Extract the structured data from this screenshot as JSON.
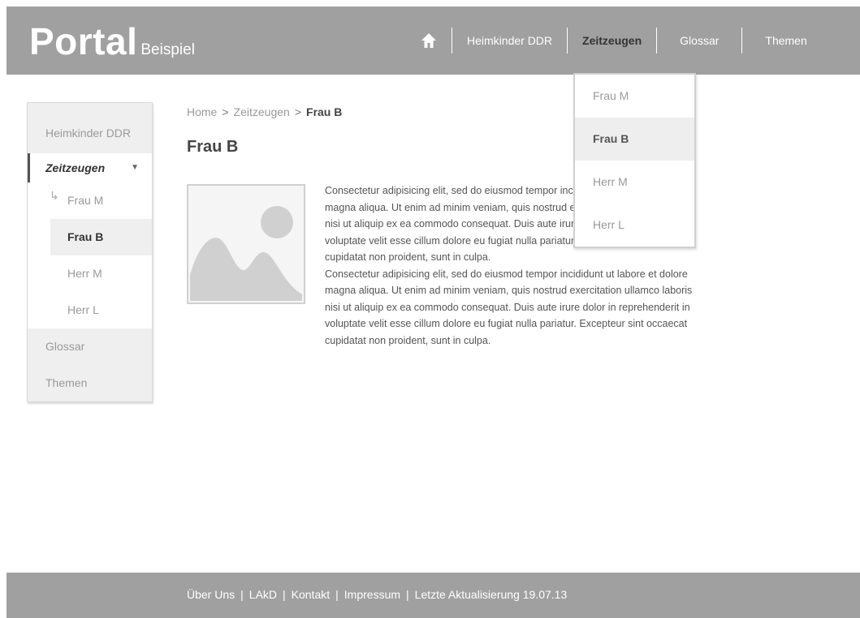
{
  "header": {
    "logo_main": "Portal",
    "logo_sub": "Beispiel",
    "home_icon": "home-icon",
    "nav": [
      {
        "label": "Heimkinder DDR"
      },
      {
        "label": "Zeitzeugen"
      },
      {
        "label": "Glossar"
      },
      {
        "label": "Themen"
      }
    ]
  },
  "dropdown": {
    "items": [
      {
        "label": "Frau M"
      },
      {
        "label": "Frau B"
      },
      {
        "label": "Herr M"
      },
      {
        "label": "Herr L"
      }
    ]
  },
  "sidebar": {
    "items": [
      {
        "label": "Heimkinder DDR"
      },
      {
        "label": "Zeitzeugen"
      },
      {
        "label": "Frau M"
      },
      {
        "label": "Frau B"
      },
      {
        "label": "Herr M"
      },
      {
        "label": "Herr L"
      },
      {
        "label": "Glossar"
      },
      {
        "label": "Themen"
      }
    ]
  },
  "breadcrumb": {
    "items": [
      "Home",
      "Zeitzeugen",
      "Frau B"
    ],
    "separator": ">"
  },
  "main": {
    "title": "Frau B",
    "image_icon": "image-placeholder-icon",
    "paragraphs": [
      "Consectetur adipisicing elit, sed do eiusmod tempor incididunt ut labore et dolore magna aliqua. Ut enim ad minim veniam, quis nostrud exercitation ullamco laboris nisi ut aliquip ex ea commodo consequat. Duis aute irure dolor in reprehenderit in voluptate velit esse cillum dolore eu fugiat nulla pariatur. Excepteur sint occaecat cupidatat non proident, sunt in culpa.",
      "Consectetur adipisicing elit, sed do eiusmod tempor incididunt ut labore et dolore magna aliqua. Ut enim ad minim veniam, quis nostrud exercitation ullamco laboris nisi ut aliquip ex ea commodo consequat. Duis aute irure dolor in reprehenderit in voluptate velit esse cillum dolore eu fugiat nulla pariatur. Excepteur sint occaecat cupidatat non proident, sunt in culpa."
    ]
  },
  "footer": {
    "links": [
      "Über Uns",
      "LAkD",
      "Kontakt",
      "Impressum",
      "Letzte Aktualisierung 19.07.13"
    ],
    "separator": "|"
  },
  "colors": {
    "bar": "#a0a0a0",
    "highlight": "#efefef"
  }
}
